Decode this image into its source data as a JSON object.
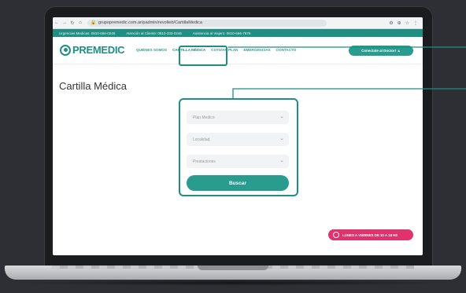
{
  "browser": {
    "url": "grupopremedic.com.ar/padmin/revolteb/CartillaMedica",
    "nav_icons": [
      "back-arrow-icon",
      "forward-arrow-icon",
      "reload-icon",
      "home-icon"
    ]
  },
  "infostrip": {
    "items": [
      "Urgencias Medicas: 0810-666-0246",
      "Atención al Cliente: 0810-333-0246",
      "Asistencia al Viajero: 0810-666-7676"
    ]
  },
  "site": {
    "logo_text": "PREMEDIC",
    "nav": [
      "QUIÉNES SOMOS",
      "CARTILLA MÉDICA",
      "COTIZAR PLAN",
      "EMERGENCIAS",
      "CONTACTO"
    ],
    "cta_label": "Conectate al Doctor! ▲",
    "accent": "#1f8e83"
  },
  "page": {
    "title": "Cartilla Médica",
    "selects": [
      {
        "placeholder": "Plan Medico"
      },
      {
        "placeholder": "Localidad"
      },
      {
        "placeholder": "Prestaciones"
      }
    ],
    "search_label": "Buscar",
    "hours_label": "LUNES A VIERNES DE 10 A 18 HS"
  }
}
